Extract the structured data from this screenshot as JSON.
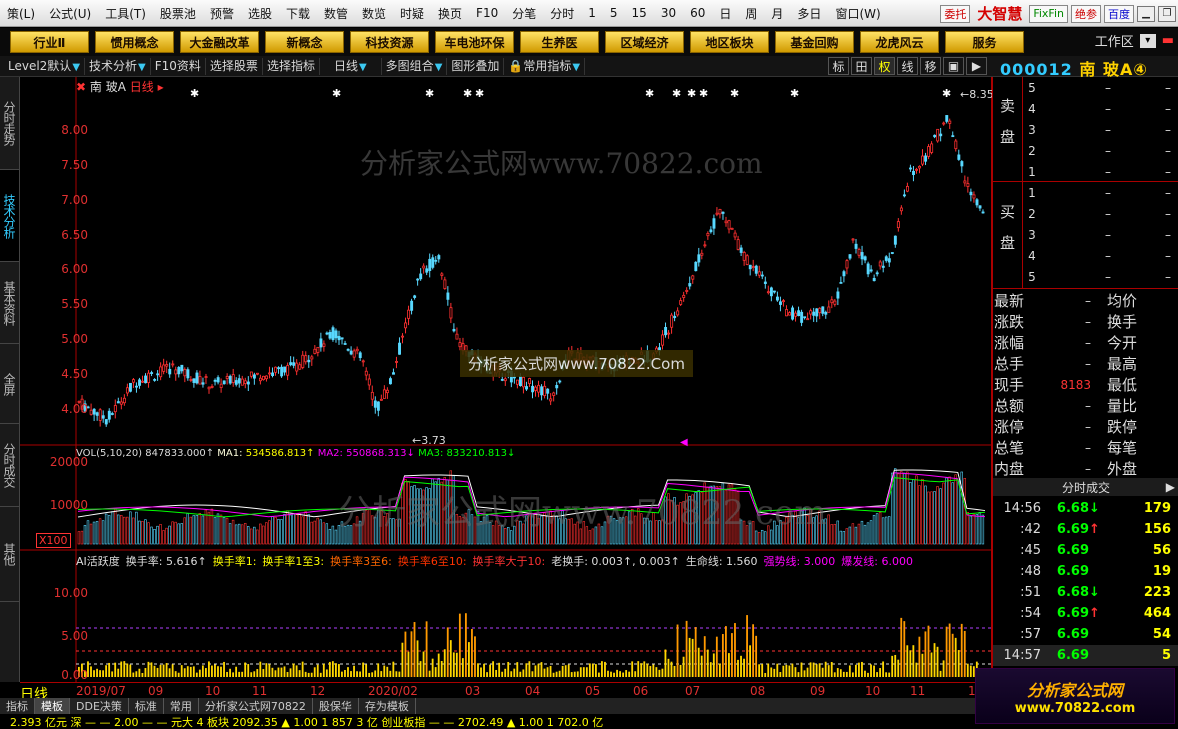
{
  "menubar": {
    "items": [
      "策(L)",
      "公式(U)",
      "工具(T)",
      "股票池",
      "预警",
      "选股",
      "下载",
      "数管",
      "数览",
      "时疑",
      "换页",
      "F10",
      "分笔",
      "分时",
      "1",
      "5",
      "15",
      "30",
      "60",
      "日",
      "周",
      "月",
      "多日",
      "窗口(W)"
    ],
    "right_buttons": [
      "委托",
      "绝参",
      "百度"
    ],
    "brand": "大智慧",
    "fixfin": "FixFin"
  },
  "sectors": {
    "buttons": [
      "行业Ⅱ",
      "惯用概念",
      "大金融改革",
      "新概念",
      "科技资源",
      "车电池环保",
      "生养医",
      "区域经济",
      "地区板块",
      "基金回购",
      "龙虎风云",
      "服务"
    ],
    "workzone_label": "工作区"
  },
  "toolbar": {
    "items": [
      "Level2默认",
      "技术分析",
      "F10资料",
      "选择股票",
      "选择指标",
      "日线",
      "多图组合",
      "图形叠加",
      "常用指标"
    ],
    "view_tabs": [
      "标",
      "田",
      "权",
      "线",
      "移",
      "▣",
      "▶"
    ],
    "stock_code": "000012",
    "stock_name": "南 玻A④"
  },
  "left_tabs": [
    "分时走势",
    "技术分析",
    "基本资料",
    "全屏",
    "分时成交",
    "其他"
  ],
  "chart": {
    "stock_label": "南 玻A",
    "period_label": "日线",
    "price_axis": [
      "8.00",
      "7.50",
      "7.00",
      "6.50",
      "6.00",
      "5.50",
      "5.00",
      "4.50",
      "4.00"
    ],
    "high_marker": "8.35",
    "low_marker": "3.73",
    "vol": {
      "title": "VOL(5,10,20)",
      "value": "847833.000↑",
      "ma1_label": "MA1:",
      "ma1": "534586.813↑",
      "ma2_label": "MA2:",
      "ma2": "550868.313↓",
      "ma3_label": "MA3:",
      "ma3": "833210.813↓",
      "axis": [
        "20000",
        "10000"
      ],
      "unit": "X100"
    },
    "ai": {
      "title": "AI活跃度",
      "items": [
        "换手率: 5.616↑",
        "换手率1:",
        "换手率1至3:",
        "换手率3至6:",
        "换手率6至10:",
        "换手率大于10:",
        "老换手: 0.003↑, 0.003↑",
        "生命线: 1.560",
        "强势线: 3.000",
        "爆发线: 6.000"
      ],
      "axis": [
        "10.00",
        "5.00",
        "0.00"
      ]
    },
    "date_axis": [
      "日线",
      "2019/07",
      "09",
      "10",
      "11",
      "12",
      "2020/02",
      "03",
      "04",
      "05",
      "06",
      "07",
      "08",
      "09",
      "10",
      "11",
      "1"
    ],
    "watermark": "分析家公式网www.70822.com",
    "watermark_mid": "分析家公式网www.70822.Com"
  },
  "chart_data": {
    "type": "candlestick",
    "title": "南 玻A 日线",
    "y_range": [
      3.6,
      8.5
    ],
    "period_start": "2019/07",
    "period_end": "2020/11",
    "high": 8.35,
    "low": 3.73,
    "overlays": [
      "VOL(5,10,20)",
      "AI活跃度"
    ],
    "last_close": 6.69
  },
  "right": {
    "sell_label": "卖盘",
    "buy_label": "买盘",
    "sell_rows": [
      {
        "lv": "5",
        "px": "–",
        "vol": "–"
      },
      {
        "lv": "4",
        "px": "–",
        "vol": "–"
      },
      {
        "lv": "3",
        "px": "–",
        "vol": "–"
      },
      {
        "lv": "2",
        "px": "–",
        "vol": "–"
      },
      {
        "lv": "1",
        "px": "–",
        "vol": "–"
      }
    ],
    "buy_rows": [
      {
        "lv": "1",
        "px": "–",
        "vol": "–"
      },
      {
        "lv": "2",
        "px": "–",
        "vol": "–"
      },
      {
        "lv": "3",
        "px": "–",
        "vol": "–"
      },
      {
        "lv": "4",
        "px": "–",
        "vol": "–"
      },
      {
        "lv": "5",
        "px": "–",
        "vol": "–"
      }
    ],
    "quote_rows": [
      {
        "k1": "最新",
        "v1": "–",
        "k2": "均价",
        "v2": ""
      },
      {
        "k1": "涨跌",
        "v1": "–",
        "k2": "换手",
        "v2": ""
      },
      {
        "k1": "涨幅",
        "v1": "–",
        "k2": "今开",
        "v2": ""
      },
      {
        "k1": "总手",
        "v1": "–",
        "k2": "最高",
        "v2": ""
      },
      {
        "k1": "现手",
        "v1": "8183",
        "k2": "最低",
        "v2": ""
      },
      {
        "k1": "总额",
        "v1": "–",
        "k2": "量比",
        "v2": ""
      },
      {
        "k1": "涨停",
        "v1": "–",
        "k2": "跌停",
        "v2": ""
      },
      {
        "k1": "总笔",
        "v1": "–",
        "k2": "每笔",
        "v2": ""
      },
      {
        "k1": "内盘",
        "v1": "–",
        "k2": "外盘",
        "v2": ""
      }
    ],
    "ticks_title": "分时成交",
    "ticks": [
      {
        "t": "14:56",
        "p": "6.68",
        "dir": "↓",
        "v": "179"
      },
      {
        "t": ":42",
        "p": "6.69",
        "dir": "↑",
        "v": "156"
      },
      {
        "t": ":45",
        "p": "6.69",
        "dir": "",
        "v": "56"
      },
      {
        "t": ":48",
        "p": "6.69",
        "dir": "",
        "v": "19"
      },
      {
        "t": ":51",
        "p": "6.68",
        "dir": "↓",
        "v": "223"
      },
      {
        "t": ":54",
        "p": "6.69",
        "dir": "↑",
        "v": "464"
      },
      {
        "t": ":57",
        "p": "6.69",
        "dir": "",
        "v": "54"
      },
      {
        "t": "14:57",
        "p": "6.69",
        "dir": "",
        "v": "5"
      }
    ]
  },
  "bottom_tabs": [
    "指标",
    "模板",
    "DDE决策",
    "标准",
    "常用",
    "分析家公式网70822",
    "股保华",
    "存为模板"
  ],
  "ticker": "2.393 亿元  深  — —  2.00  — — 元大 4 板块  2092.35  ▲ 1.00  1 857 3 亿  创业板指  — —  2702.49  ▲ 1.00  1 702.0 亿",
  "brand_bottom": {
    "line1": "分析家公式网",
    "line2": "www.70822.com"
  }
}
